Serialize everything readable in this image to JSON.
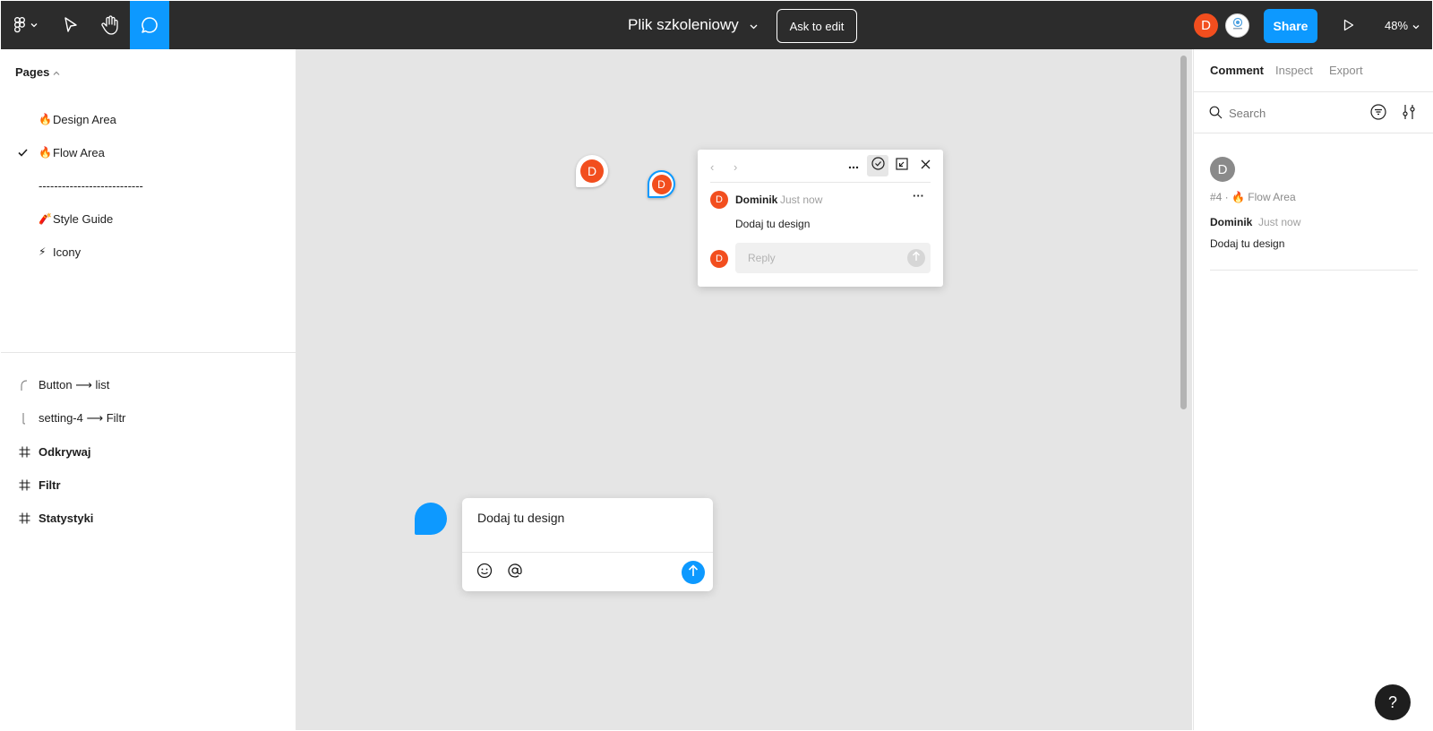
{
  "toolbar": {
    "file_title": "Plik szkoleniowy",
    "ask_to_edit": "Ask to edit",
    "share": "Share",
    "zoom": "48%",
    "user_initial": "D",
    "icons": [
      "figma-logo-icon",
      "chevron-down-icon",
      "move-pointer-icon",
      "hand-icon",
      "comment-icon",
      "play-icon"
    ]
  },
  "pages": {
    "header": "Pages",
    "items": [
      {
        "emoji": "🔥",
        "label": "Design Area",
        "selected": false
      },
      {
        "emoji": "🔥",
        "label": "Flow Area",
        "selected": true
      },
      {
        "emoji": "",
        "label": "---------------------------",
        "selected": false
      },
      {
        "emoji": "🧨",
        "label": "Style Guide",
        "selected": false
      },
      {
        "emoji": "⚡",
        "label": "Icony",
        "selected": false
      }
    ]
  },
  "layers": [
    {
      "label": "Button ⟶ list",
      "icon": "connector-icon",
      "bold": false
    },
    {
      "label": "setting-4 ⟶ Filtr",
      "icon": "connector-icon",
      "bold": false
    },
    {
      "label": "Odkrywaj",
      "icon": "frame-icon",
      "bold": true
    },
    {
      "label": "Filtr",
      "icon": "frame-icon",
      "bold": true
    },
    {
      "label": "Statystyki",
      "icon": "frame-icon",
      "bold": true
    }
  ],
  "canvas": {
    "pins": [
      {
        "initial": "D"
      },
      {
        "initial": "D"
      }
    ],
    "thread": {
      "author": "Dominik",
      "time": "Just now",
      "text": "Dodaj tu design",
      "initial": "D",
      "reply_placeholder": "Reply",
      "more": "···",
      "nav_prev": "‹",
      "nav_next": "›"
    },
    "composer": {
      "text": "Dodaj tu design"
    }
  },
  "right_panel": {
    "tabs": [
      "Comment",
      "Inspect",
      "Export"
    ],
    "search_placeholder": "Search",
    "comment": {
      "initial": "D",
      "meta": "#4 · 🔥 Flow Area",
      "author": "Dominik",
      "time": "Just now",
      "text": "Dodaj tu design"
    }
  },
  "help": "?",
  "colors": {
    "toolbar_bg": "#2c2c2c",
    "accent": "#0d99ff",
    "avatar": "#f24e1e",
    "canvas_bg": "#e5e5e5"
  }
}
